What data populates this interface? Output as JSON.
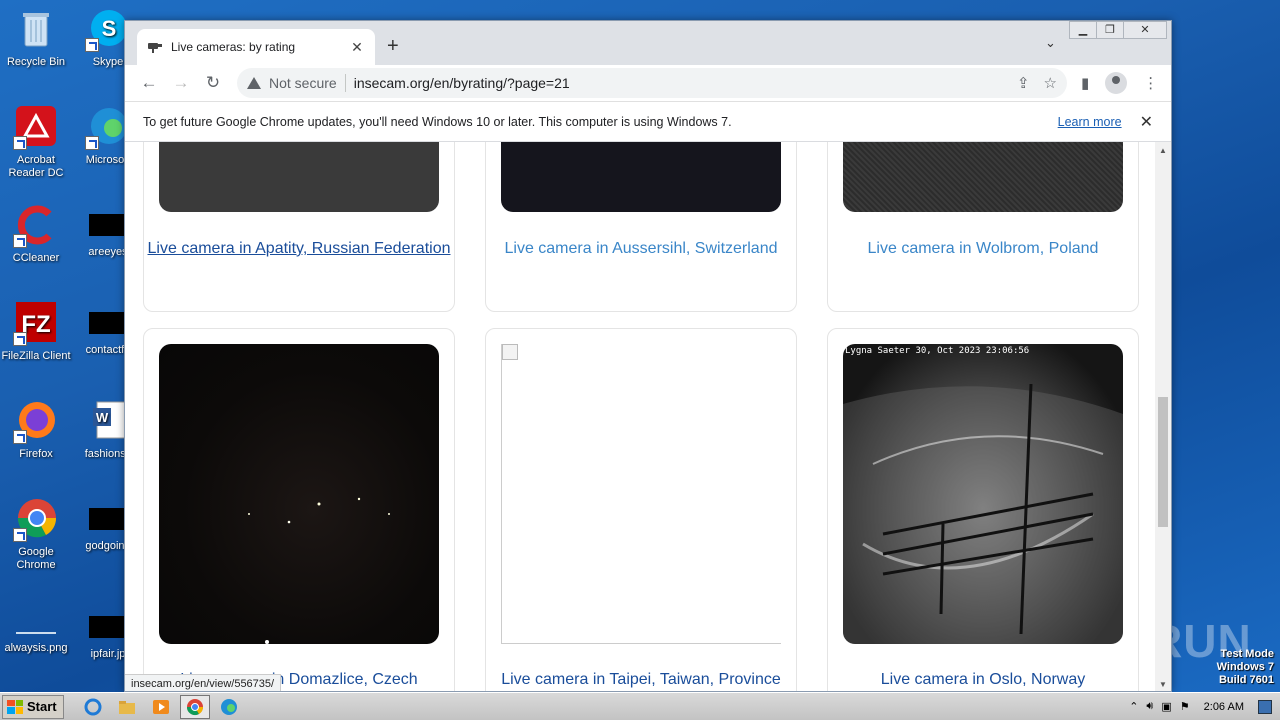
{
  "desktop": {
    "icons": [
      {
        "label": "Recycle Bin",
        "name": "recycle-bin-icon"
      },
      {
        "label": "Skype",
        "name": "skype-icon"
      },
      {
        "label": "Acrobat Reader DC",
        "name": "acrobat-icon"
      },
      {
        "label": "Microsoft",
        "name": "edge-icon"
      },
      {
        "label": "CCleaner",
        "name": "ccleaner-icon"
      },
      {
        "label": "areeyes",
        "name": "file-icon"
      },
      {
        "label": "FileZilla Client",
        "name": "filezilla-icon"
      },
      {
        "label": "contactfri",
        "name": "file-icon"
      },
      {
        "label": "Firefox",
        "name": "firefox-icon"
      },
      {
        "label": "fashionsy",
        "name": "word-doc-icon"
      },
      {
        "label": "Google Chrome",
        "name": "chrome-icon"
      },
      {
        "label": "godgoing",
        "name": "file-icon"
      },
      {
        "label": "alwaysis.png",
        "name": "image-file-icon"
      },
      {
        "label": "ipfair.jp",
        "name": "file-icon"
      }
    ]
  },
  "browser": {
    "tab_title": "Live cameras: by rating",
    "url_security": "Not secure",
    "url": "insecam.org/en/byrating/?page=21",
    "infobar_message": "To get future Google Chrome updates, you'll need Windows 10 or later. This computer is using Windows 7.",
    "infobar_link": "Learn more",
    "status_url": "insecam.org/en/view/556735/"
  },
  "cameras": {
    "row1": [
      {
        "caption": "Live camera in Apatity, Russian Federation"
      },
      {
        "caption": "Live camera in Aussersihl, Switzerland"
      },
      {
        "caption": "Live camera in Wolbrom, Poland"
      }
    ],
    "row2": [
      {
        "caption": "Live camera in Domazlice, Czech"
      },
      {
        "caption": "Live camera in Taipei, Taiwan, Province"
      },
      {
        "caption": "Live camera in Oslo, Norway"
      }
    ],
    "overlay_text_oslo": "Lygna Saeter 30, Oct 2023 23:06:56"
  },
  "taskbar": {
    "start_label": "Start",
    "clock": "2:06 AM"
  },
  "watermark": {
    "line1": "Test Mode",
    "line2": "Windows 7",
    "line3": "Build 7601",
    "brand": "ANY RUN"
  },
  "colors": {
    "link": "#3a86c8",
    "visited_link": "#1a4d9a",
    "desktop_bg": "#1a5fb0"
  }
}
